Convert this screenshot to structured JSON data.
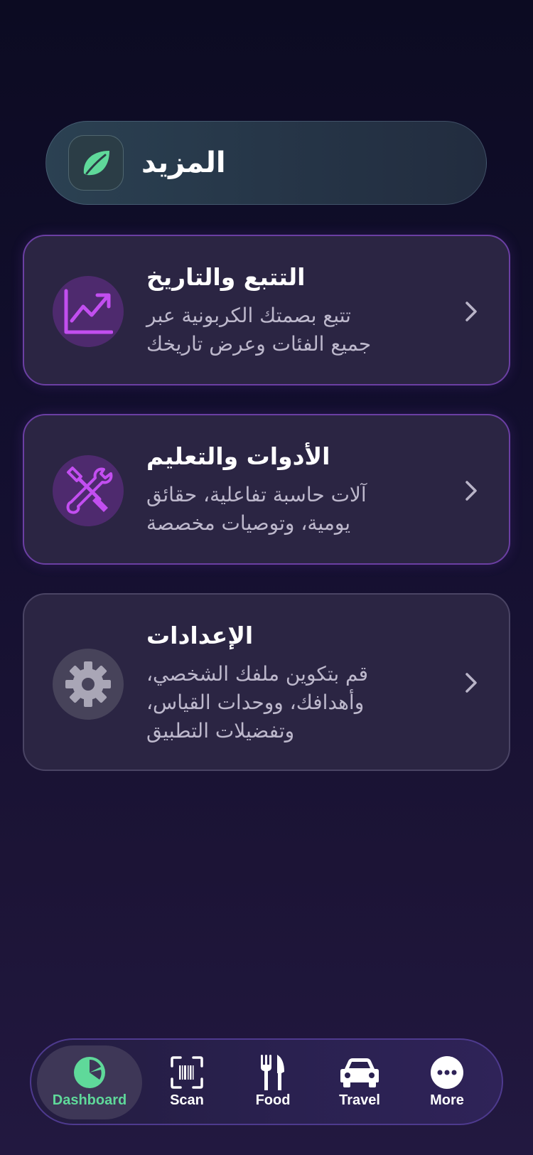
{
  "header": {
    "title": "المزيد",
    "icon": "leaf-icon",
    "accent_color": "#5fd99a"
  },
  "cards": [
    {
      "title": "التتبع والتاريخ",
      "desc_line1": "تتبع بصمتك الكربونية عبر",
      "desc_line2": "جميع الفئات وعرض تاريخك",
      "icon": "trend-chart-icon"
    },
    {
      "title": "الأدوات والتعليم",
      "desc_line1": "آلات حاسبة تفاعلية، حقائق",
      "desc_line2": "يومية، وتوصيات مخصصة",
      "icon": "tools-icon"
    },
    {
      "title": "الإعدادات",
      "desc_line1": "قم بتكوين ملفك الشخصي،",
      "desc_line2": "وأهدافك، ووحدات القياس،",
      "desc_line3": "وتفضيلات التطبيق",
      "icon": "gear-icon"
    }
  ],
  "tabbar": {
    "active": "Dashboard",
    "items": [
      {
        "label": "Dashboard",
        "icon": "pie-chart-icon"
      },
      {
        "label": "Scan",
        "icon": "barcode-scan-icon"
      },
      {
        "label": "Food",
        "icon": "fork-knife-icon"
      },
      {
        "label": "Travel",
        "icon": "car-icon"
      },
      {
        "label": "More",
        "icon": "more-dots-icon"
      }
    ]
  },
  "colors": {
    "purple_accent": "#b04ee0",
    "active_tab": "#5fd99a",
    "muted_text": "#bdb8cc"
  }
}
